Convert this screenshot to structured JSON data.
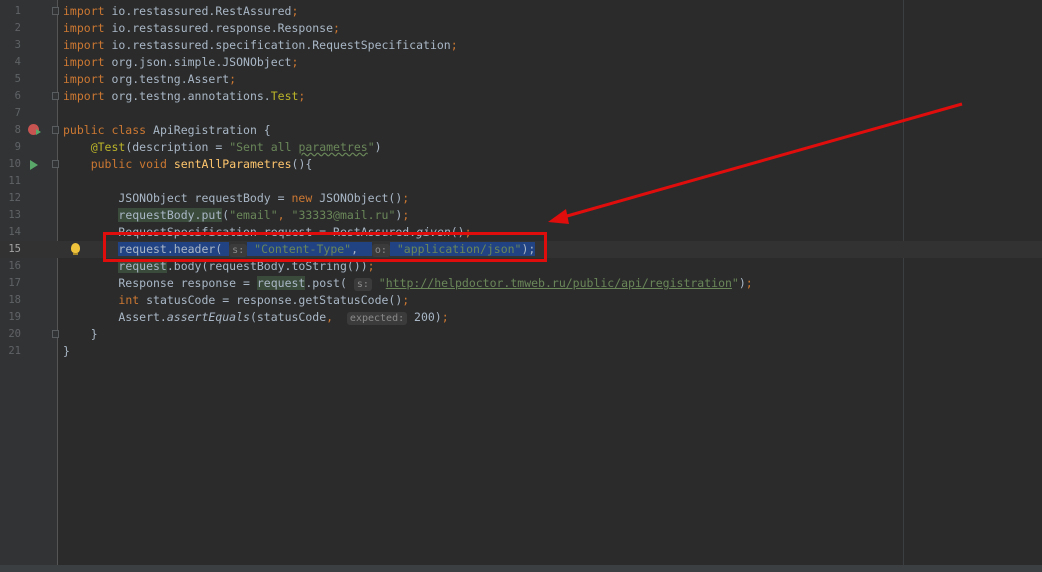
{
  "editor": {
    "lines": [
      {
        "n": "1",
        "tokens": [
          {
            "t": "import",
            "c": "kw"
          },
          {
            "t": " io.restassured.RestAssured"
          },
          {
            "t": ";",
            "c": "kw"
          }
        ]
      },
      {
        "n": "2",
        "tokens": [
          {
            "t": "import",
            "c": "kw"
          },
          {
            "t": " io.restassured.response.Response"
          },
          {
            "t": ";",
            "c": "kw"
          }
        ]
      },
      {
        "n": "3",
        "tokens": [
          {
            "t": "import",
            "c": "kw"
          },
          {
            "t": " io.restassured.specification.RequestSpecification"
          },
          {
            "t": ";",
            "c": "kw"
          }
        ]
      },
      {
        "n": "4",
        "tokens": [
          {
            "t": "import",
            "c": "kw"
          },
          {
            "t": " org.json.simple.JSONObject"
          },
          {
            "t": ";",
            "c": "kw"
          }
        ]
      },
      {
        "n": "5",
        "tokens": [
          {
            "t": "import",
            "c": "kw"
          },
          {
            "t": " org.testng.Assert"
          },
          {
            "t": ";",
            "c": "kw"
          }
        ]
      },
      {
        "n": "6",
        "tokens": [
          {
            "t": "import",
            "c": "kw"
          },
          {
            "t": " org.testng.annotations."
          },
          {
            "t": "Test",
            "c": "anno"
          },
          {
            "t": ";",
            "c": "kw"
          }
        ]
      },
      {
        "n": "7",
        "tokens": []
      },
      {
        "n": "8",
        "tokens": [
          {
            "t": "public class",
            "c": "kw"
          },
          {
            "t": " ApiRegistration {"
          }
        ]
      },
      {
        "n": "9",
        "tokens": [
          {
            "t": "    "
          },
          {
            "t": "@Test",
            "c": "anno"
          },
          {
            "t": "(description = "
          },
          {
            "t": "\"Sent all ",
            "c": "str"
          },
          {
            "t": "parametres",
            "c": "str sq"
          },
          {
            "t": "\"",
            "c": "str"
          },
          {
            "t": ")"
          }
        ]
      },
      {
        "n": "10",
        "tokens": [
          {
            "t": "    "
          },
          {
            "t": "public void",
            "c": "kw"
          },
          {
            "t": " "
          },
          {
            "t": "sentAllParametres",
            "c": "fn"
          },
          {
            "t": "(){"
          }
        ]
      },
      {
        "n": "11",
        "tokens": []
      },
      {
        "n": "12",
        "tokens": [
          {
            "t": "        JSONObject requestBody = "
          },
          {
            "t": "new",
            "c": "kw"
          },
          {
            "t": " JSONObject()"
          },
          {
            "t": ";",
            "c": "kw"
          }
        ]
      },
      {
        "n": "13",
        "tokens": [
          {
            "t": "        "
          },
          {
            "t": "requestBody.put",
            "c": "hl-used"
          },
          {
            "t": "("
          },
          {
            "t": "\"email\"",
            "c": "str"
          },
          {
            "t": ", ",
            "c": "kw"
          },
          {
            "t": "\"33333@mail.ru\"",
            "c": "str"
          },
          {
            "t": ")"
          },
          {
            "t": ";",
            "c": "kw"
          }
        ]
      },
      {
        "n": "14",
        "tokens": [
          {
            "t": "        RequestSpecification request = RestAssured."
          },
          {
            "t": "given",
            "c": "it"
          },
          {
            "t": "()"
          },
          {
            "t": ";",
            "c": "kw"
          }
        ]
      },
      {
        "n": "15",
        "current": true,
        "tokens": [
          {
            "t": "        "
          },
          {
            "t": "request.header( ",
            "c": "hl-sel"
          },
          {
            "t": "s:",
            "c": "hint"
          },
          {
            "t": " ",
            "c": "hl-sel"
          },
          {
            "t": "\"Content-Type\"",
            "c": "hl-sel str"
          },
          {
            "t": ",  ",
            "c": "hl-sel"
          },
          {
            "t": "o:",
            "c": "hint"
          },
          {
            "t": " ",
            "c": "hl-sel"
          },
          {
            "t": "\"application/json\"",
            "c": "hl-sel str"
          },
          {
            "t": ");",
            "c": "hl-sel"
          }
        ]
      },
      {
        "n": "16",
        "tokens": [
          {
            "t": "        "
          },
          {
            "t": "request",
            "c": "hl-used"
          },
          {
            "t": ".body(requestBody.toString())"
          },
          {
            "t": ";",
            "c": "kw"
          }
        ]
      },
      {
        "n": "17",
        "tokens": [
          {
            "t": "        Response response = "
          },
          {
            "t": "request",
            "c": "hl-used"
          },
          {
            "t": ".post( "
          },
          {
            "t": "s:",
            "c": "hint"
          },
          {
            "t": " "
          },
          {
            "t": "\"",
            "c": "str"
          },
          {
            "t": "http://helpdoctor.tmweb.ru/public/api/registration",
            "c": "str ul"
          },
          {
            "t": "\"",
            "c": "str"
          },
          {
            "t": ")"
          },
          {
            "t": ";",
            "c": "kw"
          }
        ]
      },
      {
        "n": "18",
        "tokens": [
          {
            "t": "        "
          },
          {
            "t": "int",
            "c": "kw"
          },
          {
            "t": " statusCode = response.getStatusCode()"
          },
          {
            "t": ";",
            "c": "kw"
          }
        ]
      },
      {
        "n": "19",
        "tokens": [
          {
            "t": "        Assert."
          },
          {
            "t": "assertEquals",
            "c": "it"
          },
          {
            "t": "(statusCode"
          },
          {
            "t": ",",
            "c": "kw"
          },
          {
            "t": "  "
          },
          {
            "t": "expected:",
            "c": "hint"
          },
          {
            "t": " 200)"
          },
          {
            "t": ";",
            "c": "kw"
          }
        ]
      },
      {
        "n": "20",
        "tokens": [
          {
            "t": "    }"
          }
        ]
      },
      {
        "n": "21",
        "tokens": [
          {
            "t": "}"
          }
        ]
      }
    ]
  },
  "colors": {
    "background": "#2b2b2b",
    "gutter": "#313335",
    "keyword": "#cc7832",
    "string": "#6a8759",
    "annotation": "#bbb529",
    "method": "#ffc66d",
    "selection": "#214283",
    "callout": "#e00d0d"
  },
  "icons": {
    "run_class": "run-class-icon",
    "run_method": "run-method-icon",
    "intention": "lightbulb-icon",
    "fold": "fold-marker-icon"
  }
}
